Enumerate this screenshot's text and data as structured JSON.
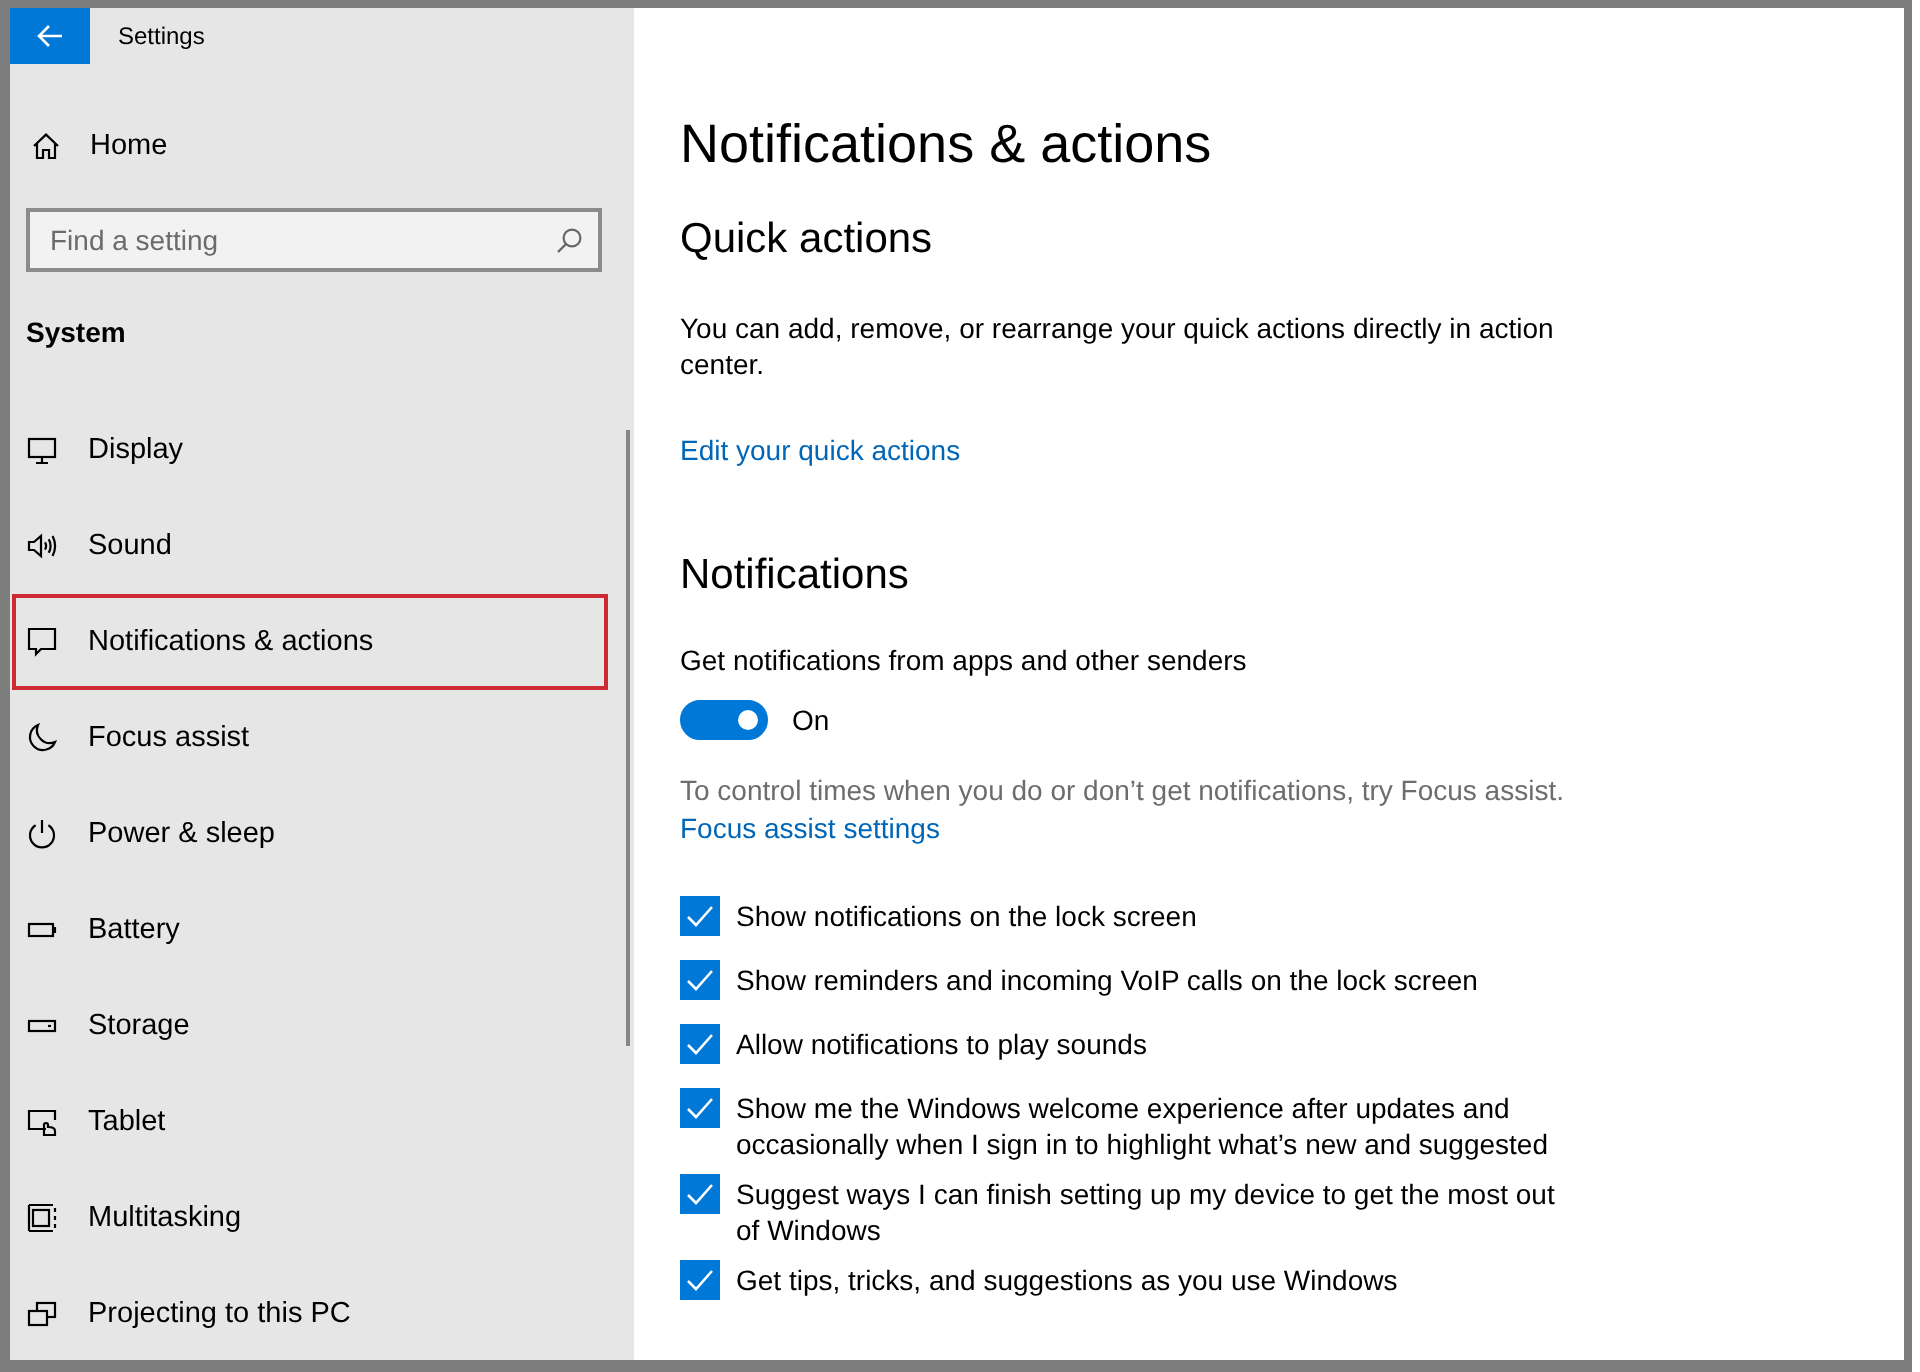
{
  "window": {
    "title": "Settings"
  },
  "sidebar": {
    "home": "Home",
    "search": {
      "placeholder": "Find a setting"
    },
    "section": "System",
    "items": [
      {
        "label": "Display",
        "selected": false
      },
      {
        "label": "Sound",
        "selected": false
      },
      {
        "label": "Notifications & actions",
        "selected": true
      },
      {
        "label": "Focus assist",
        "selected": false
      },
      {
        "label": "Power & sleep",
        "selected": false
      },
      {
        "label": "Battery",
        "selected": false
      },
      {
        "label": "Storage",
        "selected": false
      },
      {
        "label": "Tablet",
        "selected": false
      },
      {
        "label": "Multitasking",
        "selected": false
      },
      {
        "label": "Projecting to this PC",
        "selected": false
      }
    ]
  },
  "page": {
    "title": "Notifications & actions",
    "quick_actions": {
      "heading": "Quick actions",
      "description": "You can add, remove, or rearrange your quick actions directly in action center.",
      "link": "Edit your quick actions"
    },
    "notifications": {
      "heading": "Notifications",
      "toggle": {
        "label": "Get notifications from apps and other senders",
        "on": true,
        "state_text": "On"
      },
      "hint": "To control times when you do or don’t get notifications, try Focus assist.",
      "link": "Focus assist settings",
      "options": [
        {
          "label": "Show notifications on the lock screen",
          "checked": true
        },
        {
          "label": "Show reminders and incoming VoIP calls on the lock screen",
          "checked": true
        },
        {
          "label": "Allow notifications to play sounds",
          "checked": true
        },
        {
          "label": "Show me the Windows welcome experience after updates and occasionally when I sign in to highlight what’s new and suggested",
          "checked": true
        },
        {
          "label": "Suggest ways I can finish setting up my device to get the most out of Windows",
          "checked": true
        },
        {
          "label": "Get tips, tricks, and suggestions as you use Windows",
          "checked": true
        }
      ]
    }
  }
}
